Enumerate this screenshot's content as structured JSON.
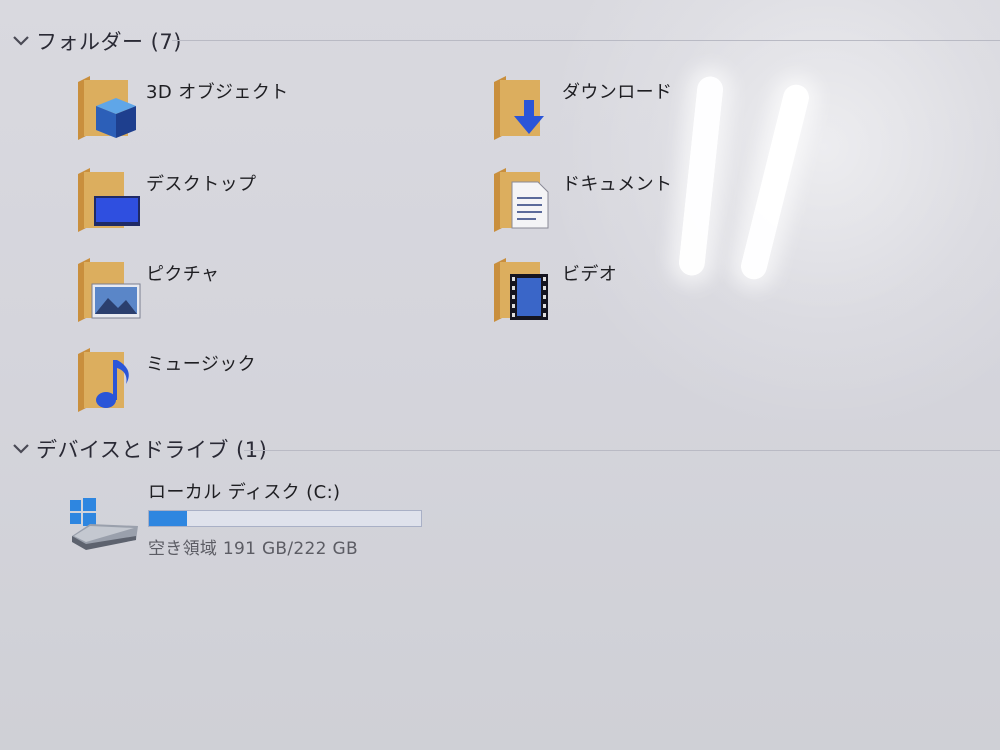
{
  "sections": {
    "folders": {
      "title": "フォルダー (7)"
    },
    "devices": {
      "title": "デバイスとドライブ (1)"
    }
  },
  "folders": [
    {
      "label": "3D オブジェクト",
      "icon": "3d-objects-folder-icon"
    },
    {
      "label": "ダウンロード",
      "icon": "downloads-folder-icon"
    },
    {
      "label": "デスクトップ",
      "icon": "desktop-folder-icon"
    },
    {
      "label": "ドキュメント",
      "icon": "documents-folder-icon"
    },
    {
      "label": "ピクチャ",
      "icon": "pictures-folder-icon"
    },
    {
      "label": "ビデオ",
      "icon": "videos-folder-icon"
    },
    {
      "label": "ミュージック",
      "icon": "music-folder-icon"
    }
  ],
  "drive": {
    "name": "ローカル ディスク (C:)",
    "free_text": "空き領域 191 GB/222 GB",
    "free_gb": 191,
    "total_gb": 222,
    "used_fraction": 0.14,
    "icon": "windows-drive-icon",
    "bar_color": "#2e86e0"
  },
  "colors": {
    "folder": "#d8a552",
    "accent_blue": "#2a55d8"
  }
}
